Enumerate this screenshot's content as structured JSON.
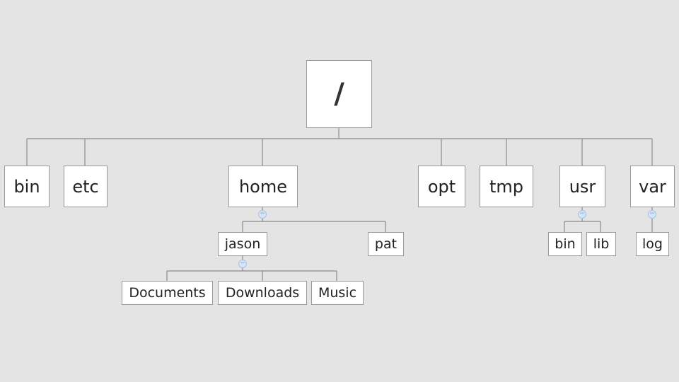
{
  "tree": {
    "root": "/",
    "level1": [
      "bin",
      "etc",
      "home",
      "opt",
      "tmp",
      "usr",
      "var"
    ],
    "home": [
      "jason",
      "pat"
    ],
    "jason": [
      "Documents",
      "Downloads",
      "Music"
    ],
    "usr": [
      "bin",
      "lib"
    ],
    "var": [
      "log"
    ]
  },
  "collapse_symbol": "−"
}
